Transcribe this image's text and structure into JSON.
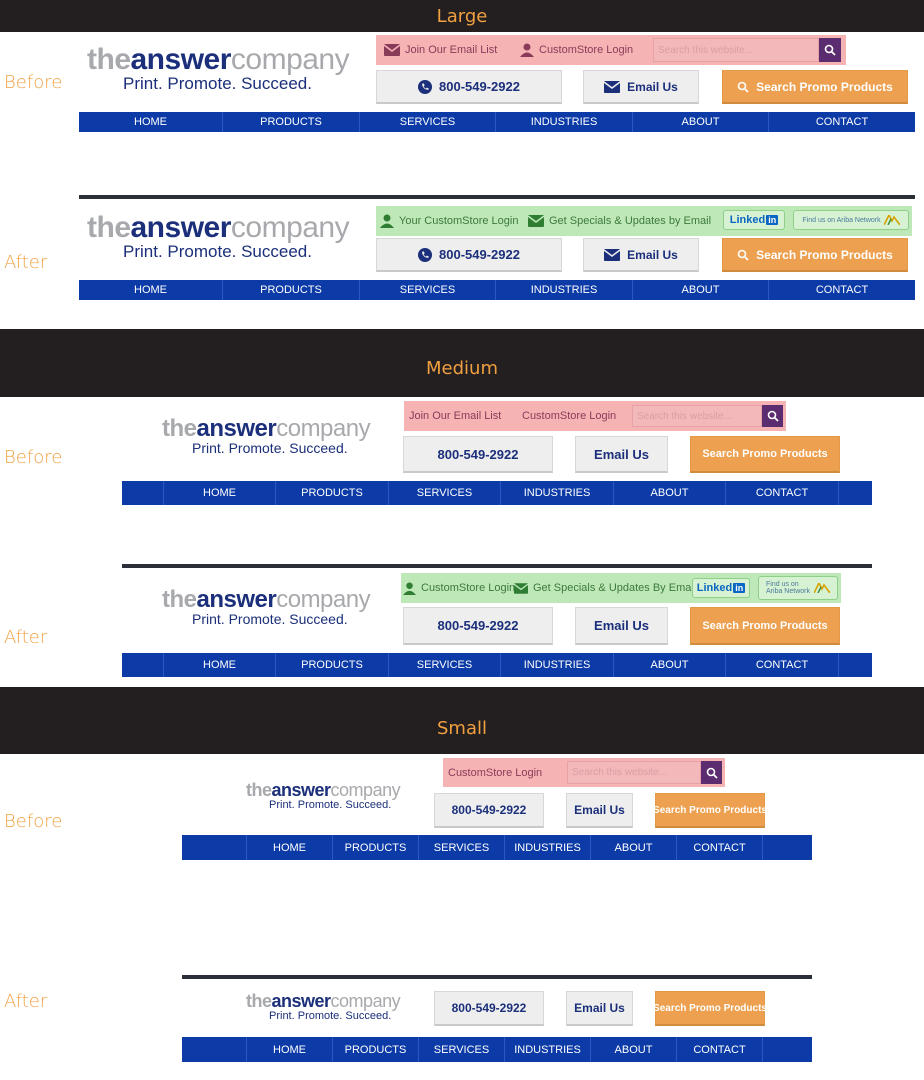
{
  "labels": {
    "large": "Large",
    "medium": "Medium",
    "small": "Small",
    "before": "Before",
    "after": "After"
  },
  "logo": {
    "the": "the",
    "answer": "answer",
    "company": "company",
    "tagline": "Print. Promote. Succeed."
  },
  "top": {
    "join_email": "Join Our Email List",
    "customstore_login": "CustomStore Login",
    "your_customstore_login": "Your CustomStore Login",
    "specials_email": "Get Specials & Updates by Email",
    "specials_email_caps": "Get Specials & Updates By Email",
    "search_placeholder": "Search this website...",
    "linkedin": "Linked",
    "linkedin_in": "in",
    "ariba": "Find us on Ariba Network",
    "ariba_l1": "Find us on",
    "ariba_l2": "Ariba Network"
  },
  "buttons": {
    "phone": "800-549-2922",
    "email": "Email Us",
    "search": "Search Promo Products"
  },
  "nav": [
    "HOME",
    "PRODUCTS",
    "SERVICES",
    "INDUSTRIES",
    "ABOUT",
    "CONTACT"
  ],
  "colors": {
    "band": "#231f20",
    "accent": "#f0a040",
    "nav": "#0c3aa6",
    "brand_navy": "#1b2f7a",
    "red_bar": "#f6b3b3",
    "green_bar": "#bfe8b9",
    "orange_btn": "#eda04f"
  }
}
